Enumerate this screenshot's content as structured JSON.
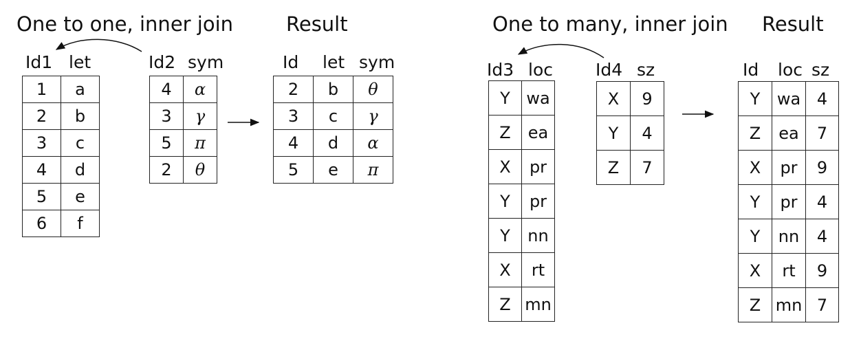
{
  "left": {
    "title": "One to one, inner join",
    "result_title": "Result",
    "table1": {
      "headers": [
        "Id1",
        "let"
      ],
      "rows": [
        [
          "1",
          "a"
        ],
        [
          "2",
          "b"
        ],
        [
          "3",
          "c"
        ],
        [
          "4",
          "d"
        ],
        [
          "5",
          "e"
        ],
        [
          "6",
          "f"
        ]
      ]
    },
    "table2": {
      "headers": [
        "Id2",
        "sym"
      ],
      "rows": [
        [
          "4",
          "α"
        ],
        [
          "3",
          "γ"
        ],
        [
          "5",
          "π"
        ],
        [
          "2",
          "θ"
        ]
      ]
    },
    "result": {
      "headers": [
        "Id",
        "let",
        "sym"
      ],
      "rows": [
        [
          "2",
          "b",
          "θ"
        ],
        [
          "3",
          "c",
          "γ"
        ],
        [
          "4",
          "d",
          "α"
        ],
        [
          "5",
          "e",
          "π"
        ]
      ]
    }
  },
  "right": {
    "title": "One to many, inner join",
    "result_title": "Result",
    "table1": {
      "headers": [
        "Id3",
        "loc"
      ],
      "rows": [
        [
          "Y",
          "wa"
        ],
        [
          "Z",
          "ea"
        ],
        [
          "X",
          "pr"
        ],
        [
          "Y",
          "pr"
        ],
        [
          "Y",
          "nn"
        ],
        [
          "X",
          "rt"
        ],
        [
          "Z",
          "mn"
        ]
      ]
    },
    "table2": {
      "headers": [
        "Id4",
        "sz"
      ],
      "rows": [
        [
          "X",
          "9"
        ],
        [
          "Y",
          "4"
        ],
        [
          "Z",
          "7"
        ]
      ]
    },
    "result": {
      "headers": [
        "Id",
        "loc",
        "sz"
      ],
      "rows": [
        [
          "Y",
          "wa",
          "4"
        ],
        [
          "Z",
          "ea",
          "7"
        ],
        [
          "X",
          "pr",
          "9"
        ],
        [
          "Y",
          "pr",
          "4"
        ],
        [
          "Y",
          "nn",
          "4"
        ],
        [
          "X",
          "rt",
          "9"
        ],
        [
          "Z",
          "mn",
          "7"
        ]
      ]
    }
  }
}
